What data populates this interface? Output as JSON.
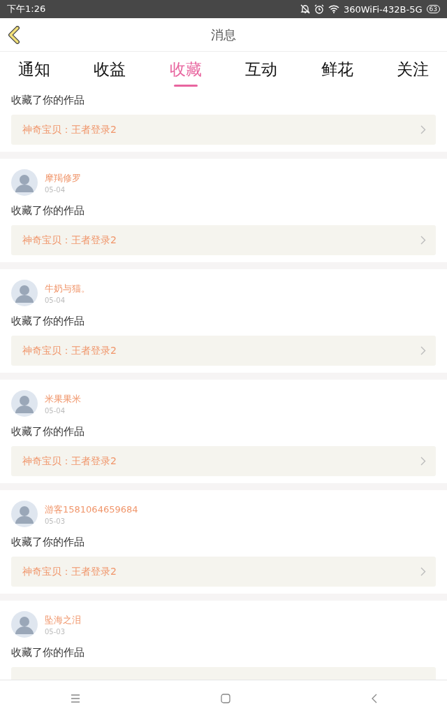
{
  "status_bar": {
    "time": "下午1:26",
    "network": "360WiFi-432B-5G",
    "battery": "63"
  },
  "header": {
    "title": "消息"
  },
  "tabs": [
    {
      "label": "通知",
      "selected": false
    },
    {
      "label": "收益",
      "selected": false
    },
    {
      "label": "收藏",
      "selected": true
    },
    {
      "label": "互动",
      "selected": false
    },
    {
      "label": "鲜花",
      "selected": false
    },
    {
      "label": "关注",
      "selected": false
    }
  ],
  "messages": [
    {
      "action": "收藏了你的作品",
      "work": "神奇宝贝：王者登录2"
    },
    {
      "user": "摩羯修罗",
      "date": "05-04",
      "action": "收藏了你的作品",
      "work": "神奇宝贝：王者登录2"
    },
    {
      "user": "牛奶与猫。",
      "date": "05-04",
      "action": "收藏了你的作品",
      "work": "神奇宝贝：王者登录2"
    },
    {
      "user": "米果果米",
      "date": "05-04",
      "action": "收藏了你的作品",
      "work": "神奇宝贝：王者登录2"
    },
    {
      "user": "游客1581064659684",
      "date": "05-03",
      "action": "收藏了你的作品",
      "work": "神奇宝贝：王者登录2"
    },
    {
      "user": "坠海之泪",
      "date": "05-03",
      "action": "收藏了你的作品"
    }
  ]
}
